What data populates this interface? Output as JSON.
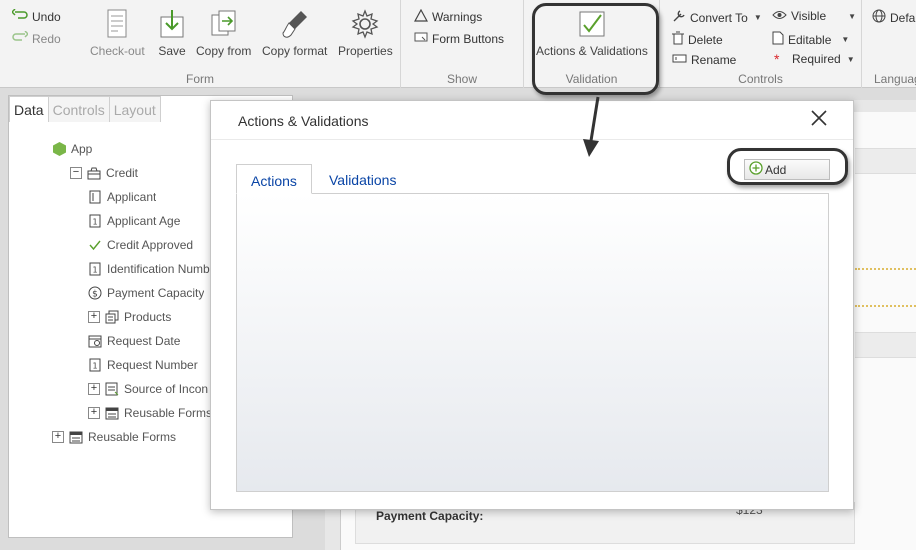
{
  "ribbon": {
    "form_group": {
      "label": "Form",
      "undo": "Undo",
      "redo": "Redo",
      "checkout": "Check-out",
      "save": "Save",
      "copy_from": "Copy from",
      "copy_format": "Copy format",
      "properties": "Properties"
    },
    "show_group": {
      "label": "Show",
      "warnings": "Warnings",
      "form_buttons": "Form Buttons"
    },
    "validation_group": {
      "label": "Validation",
      "actions_validations": "Actions & Validations"
    },
    "controls_group": {
      "label": "Controls",
      "convert_to": "Convert To",
      "delete": "Delete",
      "rename": "Rename",
      "visible": "Visible",
      "editable": "Editable",
      "required": "Required"
    },
    "language_group": {
      "label": "Languag",
      "default": "Defau"
    }
  },
  "left_panel": {
    "tabs": [
      "Data",
      "Controls",
      "Layout"
    ],
    "tree": [
      {
        "label": "App"
      },
      {
        "label": "Credit"
      },
      {
        "label": "Applicant"
      },
      {
        "label": "Applicant Age"
      },
      {
        "label": "Credit Approved"
      },
      {
        "label": "Identification Numb"
      },
      {
        "label": "Payment Capacity"
      },
      {
        "label": "Products"
      },
      {
        "label": "Request Date"
      },
      {
        "label": "Request Number"
      },
      {
        "label": "Source of Incon"
      },
      {
        "label": "Reusable Forms"
      },
      {
        "label": "Reusable Forms"
      }
    ]
  },
  "dialog": {
    "title": "Actions & Validations",
    "tabs": [
      "Actions",
      "Validations"
    ],
    "add_label": "Add"
  },
  "background_form": {
    "payment_capacity_label": "Payment Capacity:",
    "payment_capacity_value": "$123"
  },
  "colors": {
    "tab_text": "#0a45a6",
    "app_icon": "#7ab648",
    "check": "#5aa02c"
  }
}
